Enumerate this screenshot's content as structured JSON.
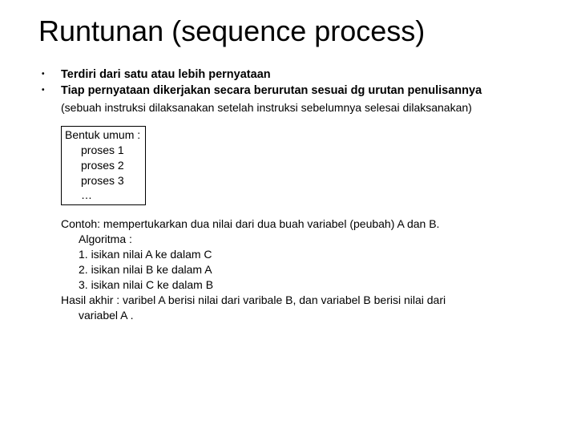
{
  "title": "Runtunan (sequence process)",
  "bullets": [
    "Terdiri dari satu atau lebih pernyataan",
    "Tiap pernyataan dikerjakan secara berurutan sesuai dg urutan penulisannya"
  ],
  "note": "(sebuah instruksi dilaksanakan setelah instruksi sebelumnya selesai dilaksanakan)",
  "general_form": {
    "header": "Bentuk umum :",
    "lines": [
      "proses 1",
      "proses 2",
      "proses 3",
      "…"
    ]
  },
  "example": {
    "intro": "Contoh: mempertukarkan dua nilai dari dua buah variabel (peubah) A dan B.",
    "algo_header": "Algoritma :",
    "steps": [
      "1. isikan nilai A ke dalam C",
      "2. isikan nilai B ke dalam A",
      "3. isikan nilai C ke dalam B"
    ],
    "result_line1": "Hasil akhir : varibel A berisi nilai dari varibale B, dan variabel B berisi nilai dari",
    "result_line2": "variabel A ."
  }
}
